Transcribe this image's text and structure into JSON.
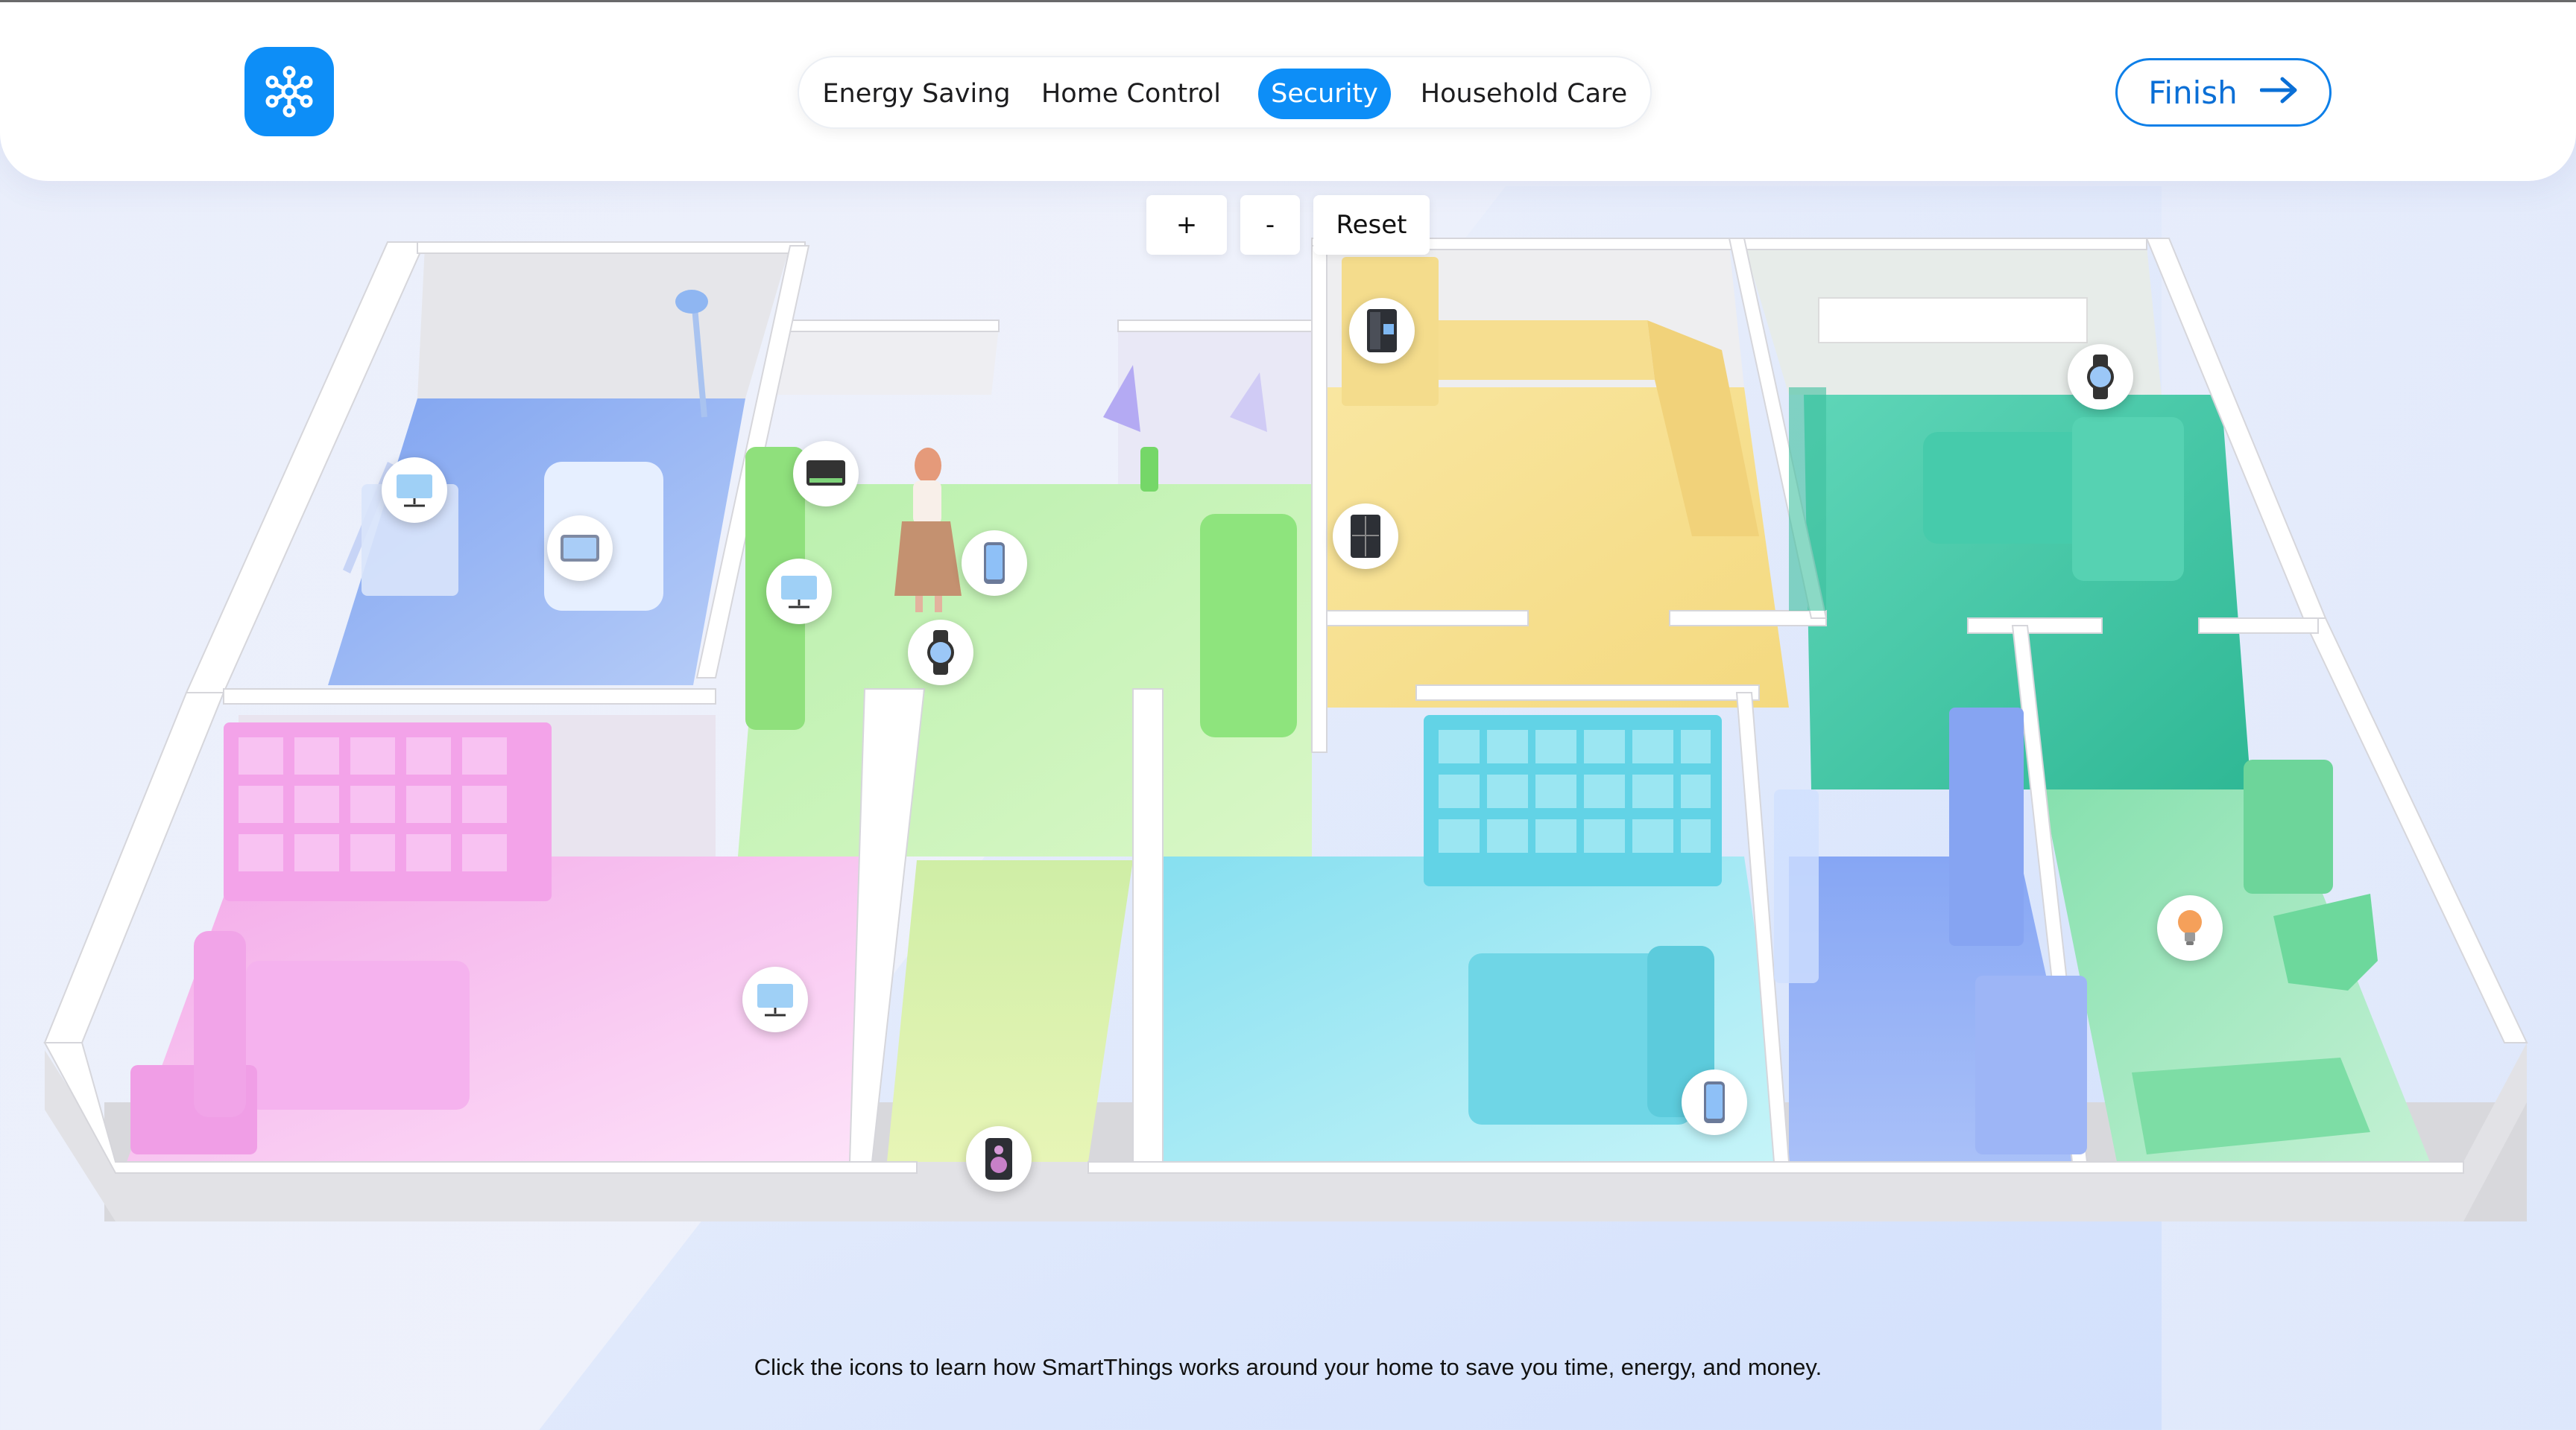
{
  "header": {
    "logo_icon": "smartthings-logo-icon",
    "tabs": [
      {
        "label": "Energy Saving",
        "active": false
      },
      {
        "label": "Home Control",
        "active": false
      },
      {
        "label": "Security",
        "active": true
      },
      {
        "label": "Household Care",
        "active": false
      }
    ],
    "finish_label": "Finish",
    "finish_icon": "arrow-right-icon"
  },
  "zoom": {
    "zoom_in_label": "+",
    "zoom_out_label": "-",
    "reset_label": "Reset"
  },
  "devices": [
    {
      "name": "tv",
      "icon": "tv-icon"
    },
    {
      "name": "tablet",
      "icon": "tablet-icon"
    },
    {
      "name": "monitor",
      "icon": "monitor-icon"
    },
    {
      "name": "tv-living",
      "icon": "tv-icon"
    },
    {
      "name": "phone",
      "icon": "phone-icon"
    },
    {
      "name": "watch",
      "icon": "watch-icon"
    },
    {
      "name": "refrigerator-top",
      "icon": "refrigerator-icon"
    },
    {
      "name": "refrigerator",
      "icon": "refrigerator-icon"
    },
    {
      "name": "watch-bedroom",
      "icon": "watch-icon"
    },
    {
      "name": "tv-pink-room",
      "icon": "tv-icon"
    },
    {
      "name": "speaker",
      "icon": "speaker-icon"
    },
    {
      "name": "phone-bedroom",
      "icon": "phone-icon"
    },
    {
      "name": "smart-bulb",
      "icon": "lightbulb-icon"
    }
  ],
  "colors": {
    "accent": "#0d8ef7",
    "room_blue": "#8fb0f2",
    "room_green": "#a6e89a",
    "room_yellow": "#f6df8f",
    "room_teal": "#3fc9a7",
    "room_pink": "#f7b7ec",
    "room_cyan": "#9fe6f2",
    "room_periwinkle": "#9db6f6",
    "room_mint": "#8fe6b4"
  },
  "caption": "Click the icons to learn how SmartThings works around your home to save you time, energy, and money."
}
